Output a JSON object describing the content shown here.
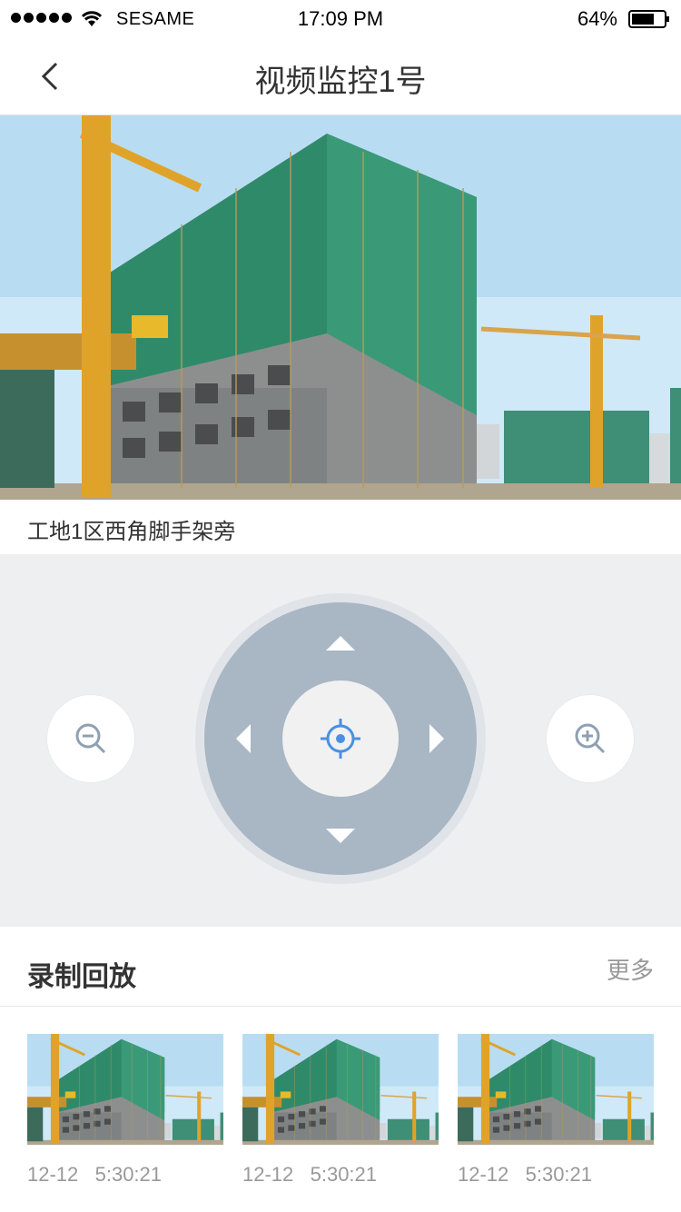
{
  "status": {
    "carrier": "SESAME",
    "time": "17:09 PM",
    "battery": "64%"
  },
  "nav": {
    "title": "视频监控1号"
  },
  "video": {
    "location": "工地1区西角脚手架旁"
  },
  "playback": {
    "title": "录制回放",
    "more": "更多",
    "items": [
      {
        "time": "12-12   5:30:21"
      },
      {
        "time": "12-12   5:30:21"
      },
      {
        "time": "12-12   5:30:21"
      }
    ]
  },
  "colors": {
    "accent": "#4a90e2",
    "pad": "#a9b6c4",
    "panel_bg": "#eeeff1"
  },
  "icons": [
    "back-icon",
    "zoom-out-icon",
    "zoom-in-icon",
    "target-icon"
  ]
}
